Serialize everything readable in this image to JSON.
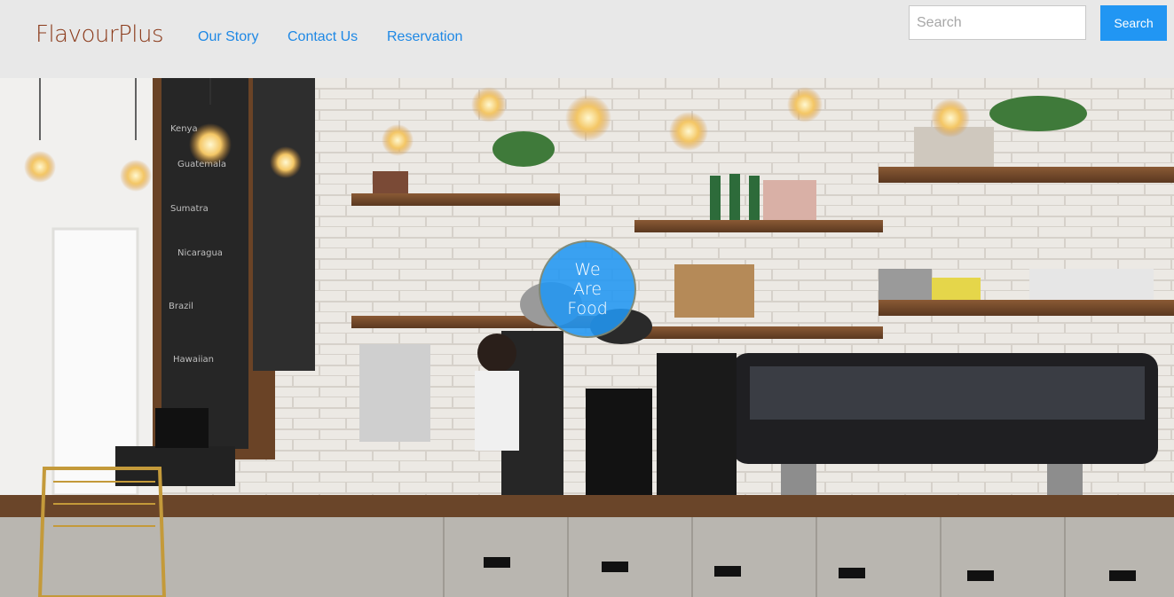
{
  "brand": {
    "name": "FlavourPlus"
  },
  "nav": {
    "links": [
      "Our Story",
      "Contact Us",
      "Reservation"
    ]
  },
  "search": {
    "placeholder": "Search",
    "value": "",
    "button_label": "Search"
  },
  "hero": {
    "badge_lines": [
      "We",
      "Are",
      "Food"
    ]
  },
  "colors": {
    "brand": "#8b3a1a",
    "link": "#1e88e5",
    "accent": "#2196f3",
    "navbar_bg": "#e8e8e8"
  }
}
